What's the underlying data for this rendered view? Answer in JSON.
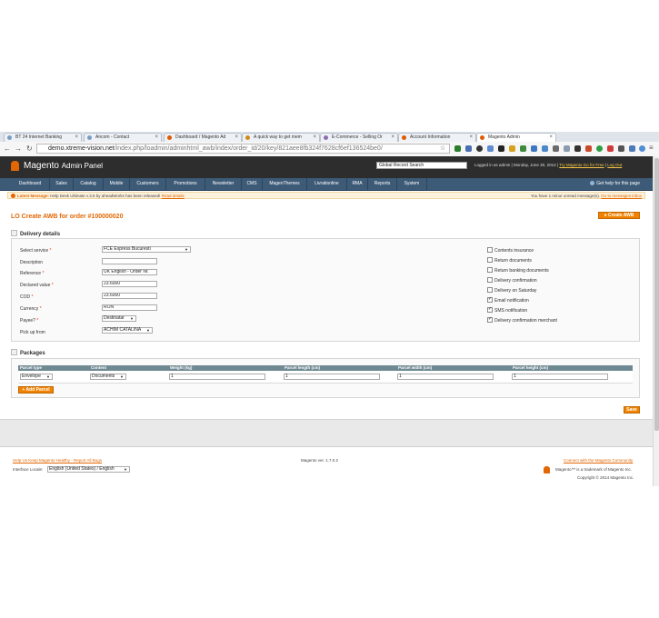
{
  "browser": {
    "tabs": [
      {
        "title": "BT 24 Internet Banking",
        "active": false
      },
      {
        "title": "Ancom - Contact",
        "active": false
      },
      {
        "title": "Dashboard / Magento Ad",
        "active": false
      },
      {
        "title": "A quick way to get mem",
        "active": false
      },
      {
        "title": "E-Commerce - Selling Or",
        "active": false
      },
      {
        "title": "Account Information",
        "active": false
      },
      {
        "title": "Magento Admin",
        "active": true
      }
    ],
    "url_host": "demo.xtreme-vision.net",
    "url_path": "/index.php/loadmin/adminhtml_awb/index/order_id/20/key/821aee8fb324f7628cf6ef136524be0/"
  },
  "header": {
    "logo_text": "Magento",
    "logo_sub": "Admin Panel",
    "global_search": "Global Record Search",
    "logged_in": "Logged in as admin",
    "date": "Monday, June 30, 2014",
    "try_link": "Try Magento Go for Free",
    "logout": "Log Out"
  },
  "nav": {
    "items": [
      "Dashboard",
      "Sales",
      "Catalog",
      "Mobile",
      "Customers",
      "Promotions",
      "Newsletter",
      "CMS",
      "MagenThemes",
      "Livrationline",
      "RMA",
      "Reports",
      "System"
    ],
    "help": "Get help for this page"
  },
  "message": {
    "label": "Latest Message:",
    "text": "Help Desk Ultimate v.3.6 by aheadWorks has been released!",
    "read_link": "Read details",
    "right_text": "You have 1 minor unread message(s).",
    "goto_link": "Go to messages inbox"
  },
  "page": {
    "title": "LO Create AWB for order #100000020",
    "create_button": "Create AWB",
    "save_button": "Save"
  },
  "delivery": {
    "section_title": "Delivery details",
    "fields": {
      "service": {
        "label": "Select service",
        "value": "FCE Express Bucuresti"
      },
      "description": {
        "label": "Description",
        "value": ""
      },
      "reference": {
        "label": "Reference",
        "value": "UK English - Order Nr."
      },
      "declared": {
        "label": "Declared value",
        "value": "23.6000"
      },
      "cod": {
        "label": "COD",
        "value": "23.6000"
      },
      "currency": {
        "label": "Currency",
        "value": "RON"
      },
      "payee": {
        "label": "Payee?",
        "value": "Destinatar"
      },
      "pickup": {
        "label": "Pick up from",
        "value": "ACHIM CATALINA"
      }
    },
    "required_mark": "*",
    "options": [
      {
        "label": "Contents insurance",
        "checked": false
      },
      {
        "label": "Return documents",
        "checked": false
      },
      {
        "label": "Return banking documents",
        "checked": false
      },
      {
        "label": "Delivery confirmation",
        "checked": false
      },
      {
        "label": "Delivery on Saturday",
        "checked": false
      },
      {
        "label": "Email notification",
        "checked": true
      },
      {
        "label": "SMS notification",
        "checked": true
      },
      {
        "label": "Delivery confirmation merchant",
        "checked": true
      }
    ]
  },
  "packages": {
    "section_title": "Packages",
    "columns": [
      "Parcel type",
      "Content",
      "Weight (kg)",
      "Parcel length (cm)",
      "Parcel width (cm)",
      "Parcel height (cm)"
    ],
    "row": {
      "type": "Envelope",
      "content": "Documents",
      "weight": "1",
      "length": "1",
      "width": "1",
      "height": "1"
    },
    "add_button": "+ Add Parcel"
  },
  "footer": {
    "help_link": "Help Us Keep Magento Healthy - Report All Bugs",
    "locale_label": "Interface Locale:",
    "locale_value": "English (United States) / English",
    "version": "Magento ver. 1.7.0.2",
    "community_link": "Connect with the Magento Community",
    "trademark": "Magento™ is a trademark of Magento Inc.",
    "copyright": "Copyright © 2014 Magento Inc."
  },
  "colors": {
    "accent": "#e26703",
    "nav": "#3d5a76",
    "header": "#2d2d2d",
    "button": "#f18200"
  }
}
